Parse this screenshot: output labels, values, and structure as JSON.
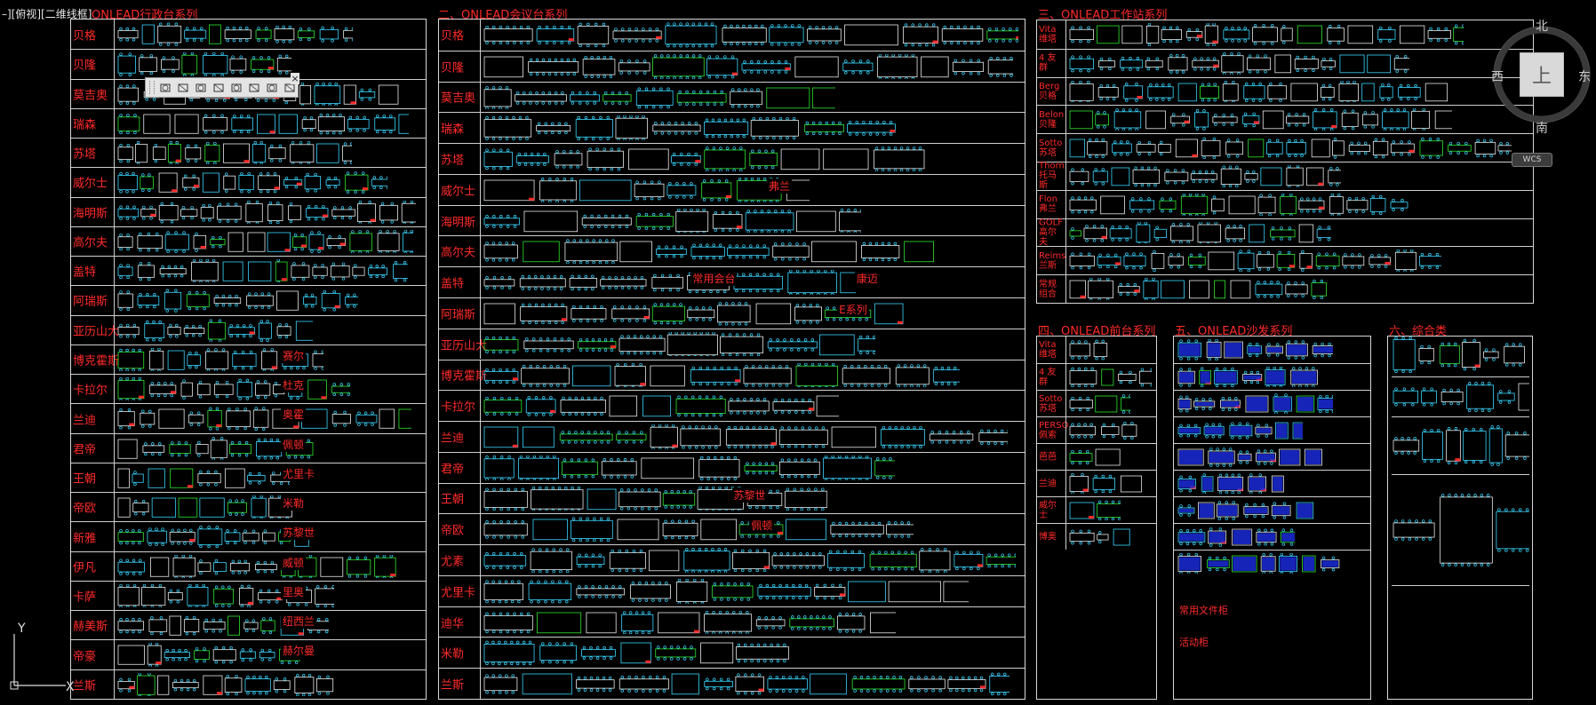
{
  "viewport": {
    "label": "–][俯视][二维线框]"
  },
  "colors": {
    "background": "#000000",
    "red": "#ff2a2a",
    "cyan": "#39d6ff",
    "green": "#2ee62e",
    "white": "#e8e8e8",
    "blue": "#1a2bd8",
    "magenta": "#ff33ff"
  },
  "sections": {
    "executive": {
      "title": "ONLEAD行政台系列",
      "rows": [
        "贝格",
        "贝隆",
        "莫吉奥",
        "瑞森",
        "苏塔",
        "威尔士",
        "海明斯",
        "高尔夫",
        "盖特",
        "阿瑞斯",
        "亚历山大",
        "博克霍斯",
        "卡拉尔",
        "兰迪",
        "君帝",
        "王朝",
        "帝欧",
        "新雅",
        "伊凡",
        "卡萨",
        "赫美斯",
        "帝豪",
        "兰斯"
      ],
      "side_labels": [
        "赛尔",
        "杜克",
        "奥霍",
        "佩顿",
        "尤里卡",
        "米勒",
        "苏黎世",
        "威顿",
        "里奥",
        "纽西兰",
        "赫尔曼"
      ]
    },
    "conference": {
      "title": "二、ONLEAD会议台系列",
      "rows": [
        "贝格",
        "贝隆",
        "莫吉奥",
        "瑞森",
        "苏塔",
        "威尔士",
        "海明斯",
        "高尔夫",
        "盖特",
        "阿瑞斯",
        "亚历山大",
        "博克霍斯",
        "卡拉尔",
        "兰迪",
        "君帝",
        "王朝",
        "帝欧",
        "尤素",
        "尤里卡",
        "迪华",
        "米勒",
        "兰斯"
      ],
      "side_labels": [
        "弗兰",
        "常用会台",
        "康迈",
        "E系列",
        "苏黎世",
        "佩顿"
      ]
    },
    "workstation": {
      "title": "三、ONLEAD工作站系列",
      "rows": [
        "Vita 维塔",
        "4 友群",
        "Berg 贝格",
        "Belon 贝隆",
        "Sotto 苏塔",
        "Thorn 托马斯",
        "Flon 弗兰",
        "GOLF 高尔夫",
        "Reims 兰斯",
        "常规组合"
      ]
    },
    "reception": {
      "title": "四、ONLEAD前台系列",
      "rows": [
        "Vita 维塔",
        "4 友群",
        "Sotto 苏塔",
        "PERSO 佩索",
        "芭芭",
        "兰迪",
        "威尔士",
        "博奥"
      ]
    },
    "sofa": {
      "title": "五、ONLEAD沙发系列",
      "bottom_labels": [
        "常用文件柜",
        "活动柜"
      ]
    },
    "misc": {
      "title": "六、综合类"
    }
  },
  "toolbar": {
    "buttons": [
      "view-cube-icon",
      "front-view-icon",
      "top-view-icon",
      "back-view-icon",
      "left-view-icon",
      "right-view-icon",
      "iso-view-icon",
      "camera-icon"
    ],
    "close_label": "×"
  },
  "viewcube": {
    "north": "北",
    "south": "南",
    "east": "东",
    "west": "西",
    "top": "上",
    "wcs": "WCS"
  },
  "ucs": {
    "x": "X",
    "y": "Y"
  }
}
